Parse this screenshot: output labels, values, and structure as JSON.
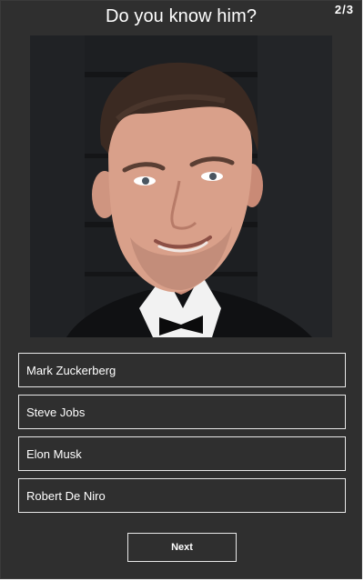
{
  "quiz": {
    "question": "Do you know him?",
    "progress": "2/3",
    "current_question": 2,
    "total_questions": 3
  },
  "photo": {
    "subject": "portrait-photo"
  },
  "options": [
    {
      "label": "Mark Zuckerberg"
    },
    {
      "label": "Steve Jobs"
    },
    {
      "label": "Elon Musk"
    },
    {
      "label": "Robert De Niro"
    }
  ],
  "actions": {
    "next_label": "Next"
  },
  "colors": {
    "background": "#2f2f2f",
    "text": "#ffffff",
    "border": "#e8e8e8"
  }
}
